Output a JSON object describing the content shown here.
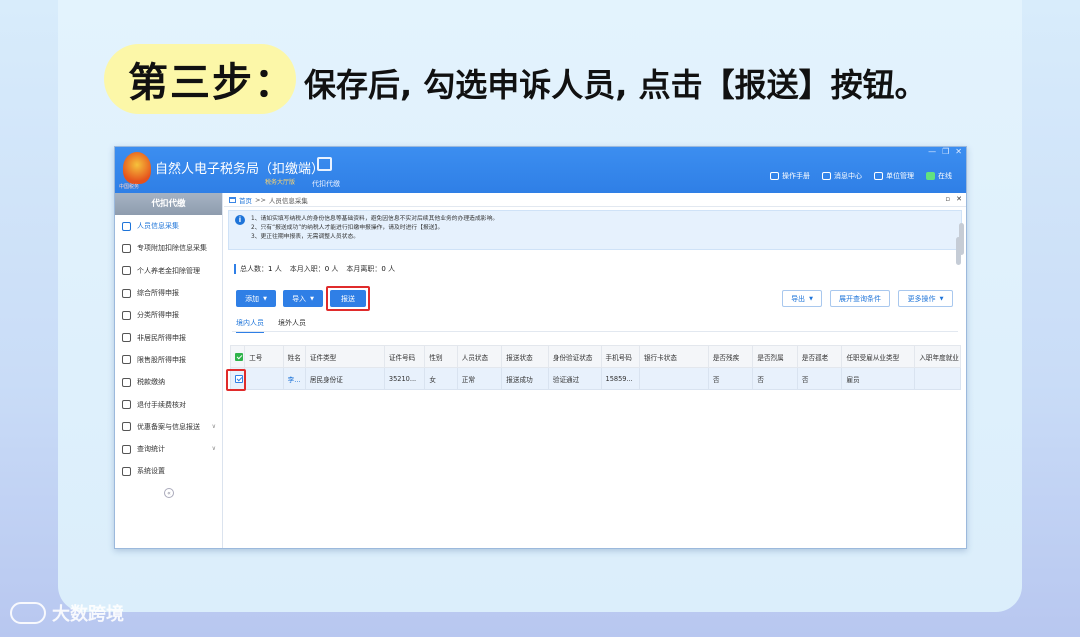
{
  "header": {
    "step_label": "第三步：",
    "description": "保存后, 勾选申诉人员, 点击【报送】按钮。"
  },
  "watermark": {
    "text": "大数跨境"
  },
  "app": {
    "title": "自然人电子税务局（扣缴端）",
    "hall": "税务大厅版",
    "emblem_text": "中国税务",
    "module_label": "代扣代缴",
    "top_links": [
      "操作手册",
      "消息中心",
      "单位管理",
      "在线"
    ],
    "window_controls": [
      "—",
      "❐",
      "✕"
    ]
  },
  "sidebar": {
    "header": "代扣代缴",
    "items": [
      {
        "label": "人员信息采集",
        "icon": "person-icon",
        "active": true
      },
      {
        "label": "专项附加扣除信息采集",
        "icon": "grid-icon"
      },
      {
        "label": "个人养老金扣除管理",
        "icon": "pension-icon"
      },
      {
        "label": "综合所得申报",
        "icon": "layers-icon"
      },
      {
        "label": "分类所得申报",
        "icon": "pie-icon"
      },
      {
        "label": "非居民所得申报",
        "icon": "user-icon"
      },
      {
        "label": "限售股所得申报",
        "icon": "bar-chart-icon"
      },
      {
        "label": "税款缴纳",
        "icon": "folder-icon"
      },
      {
        "label": "退付手续费核对",
        "icon": "doc-icon"
      },
      {
        "label": "优惠备案与信息报送",
        "icon": "stack-icon",
        "caret": true
      },
      {
        "label": "查询统计",
        "icon": "search-list-icon",
        "caret": true
      },
      {
        "label": "系统设置",
        "icon": "gear-icon"
      }
    ],
    "collapse": "«"
  },
  "breadcrumb": {
    "home": "首页",
    "sep": ">>",
    "current": "人员信息采集",
    "controls": [
      "▫",
      "✕"
    ]
  },
  "notice": {
    "icon": "i",
    "lines": [
      "1、请如实填写纳税人的身份信息等基础资料，避免因信息不实对后续其他业务的办理造成影响。",
      "2、只有“报送成功”的纳税人才能进行扣缴申报操作，请及时进行【报送】。",
      "3、更正往期申报表，无需调整人员状态。"
    ]
  },
  "stats": {
    "total_label": "总人数：",
    "total": "1",
    "unit1": "人",
    "hire_label": "本月入职：",
    "hire": "0",
    "unit2": "人",
    "leave_label": "本月离职：",
    "leave": "0",
    "unit3": "人"
  },
  "toolbar": {
    "add": "添加",
    "import": "导入",
    "submit": "报送",
    "export": "导出",
    "expand_query": "展开查询条件",
    "more": "更多操作",
    "caret": "▼"
  },
  "tabs": [
    "境内人员",
    "境外人员"
  ],
  "table": {
    "columns": [
      "",
      "工号",
      "姓名",
      "证件类型",
      "证件号码",
      "性别",
      "人员状态",
      "报送状态",
      "身份验证状态",
      "手机号码",
      "银行卡状态",
      "是否残疾",
      "是否烈属",
      "是否孤老",
      "任职受雇从业类型",
      "入职年度就业"
    ],
    "rows": [
      [
        "",
        "",
        "李...",
        "居民身份证",
        "35210...",
        "女",
        "正常",
        "报送成功",
        "验证通过",
        "15859...",
        "",
        "否",
        "否",
        "否",
        "雇员",
        ""
      ]
    ]
  },
  "colors": {
    "brand_blue": "#2f7fe6",
    "highlight_red": "#e02b2b",
    "pill_yellow": "#fcf7a8"
  }
}
